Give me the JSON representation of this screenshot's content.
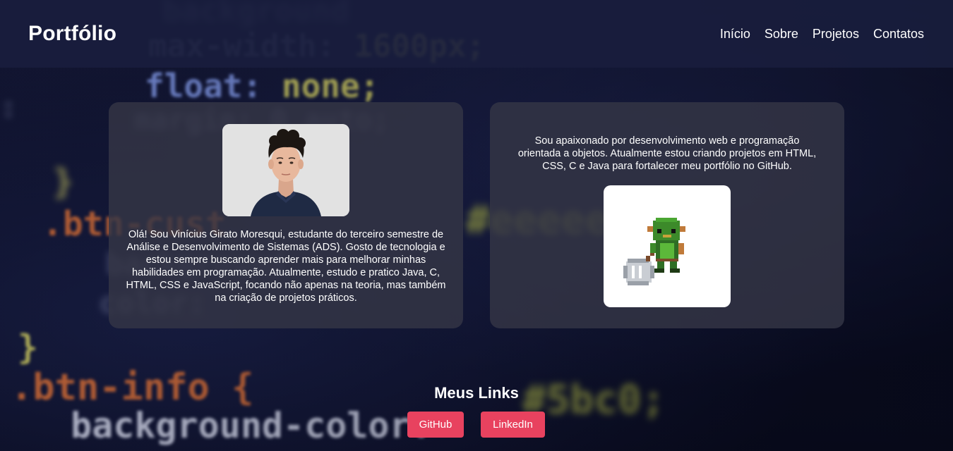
{
  "header": {
    "brand": "Portfólio",
    "nav": [
      "Início",
      "Sobre",
      "Projetos",
      "Contatos"
    ]
  },
  "about": {
    "photo_icon": "profile-photo",
    "intro": "Olá! Sou Vinícius Girato Moresqui, estudante do terceiro semestre de Análise e Desenvolvimento de Sistemas (ADS). Gosto de tecnologia e estou sempre buscando aprender mais para melhorar minhas habilidades em programação. Atualmente, estudo e pratico Java, C, HTML, CSS e JavaScript, focando não apenas na teoria, mas também na criação de projetos práticos."
  },
  "passion": {
    "text": "Sou apaixonado por desenvolvimento web e programação orientada a objetos. Atualmente estou criando projetos em HTML, CSS, C e Java para fortalecer meu portfólio no GitHub.",
    "image_icon": "pixel-goblin-sprite"
  },
  "links": {
    "title": "Meus Links",
    "github": "GitHub",
    "linkedin": "LinkedIn"
  },
  "colors": {
    "header_bg": "#191e3e",
    "card_bg": "#343646",
    "button_bg": "#e8425f",
    "text": "#ffffff"
  }
}
